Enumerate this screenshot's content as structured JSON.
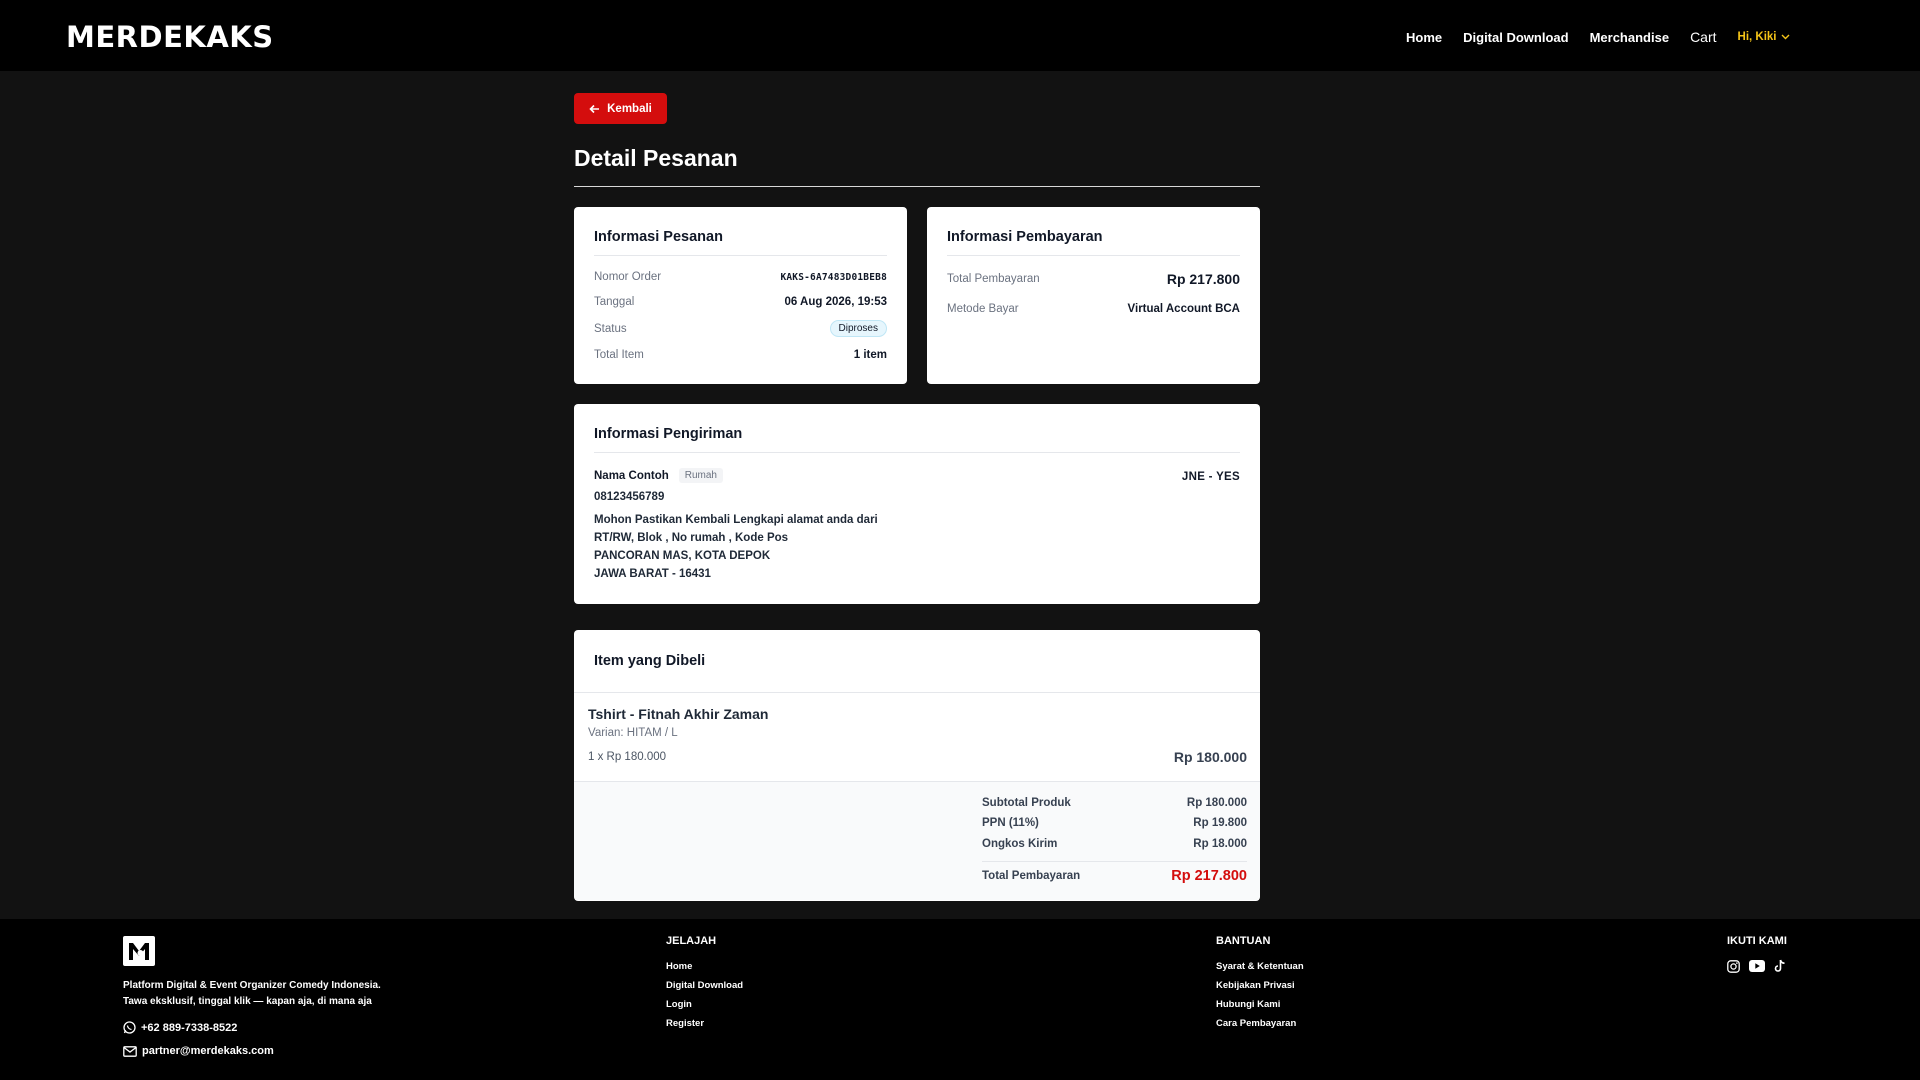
{
  "nav": {
    "logo": "MERDEKAKS",
    "links": [
      "Home",
      "Digital Download",
      "Merchandise",
      "Cart"
    ],
    "user": "Hi, Kiki"
  },
  "back_label": "Kembali",
  "page_title": "Detail Pesanan",
  "order_info": {
    "title": "Informasi Pesanan",
    "rows": [
      {
        "label": "Nomor Order",
        "value": "KAKS-6A7483D01BEB8"
      },
      {
        "label": "Tanggal",
        "value": "06 Aug 2026, 19:53"
      },
      {
        "label": "Status",
        "value": "Diproses"
      },
      {
        "label": "Total Item",
        "value": "1 item"
      }
    ]
  },
  "payment_info": {
    "title": "Informasi Pembayaran",
    "rows": [
      {
        "label": "Total Pembayaran",
        "value": "Rp 217.800"
      },
      {
        "label": "Metode Bayar",
        "value": "Virtual Account BCA"
      }
    ]
  },
  "shipping": {
    "title": "Informasi Pengiriman",
    "name": "Nama Contoh",
    "tag": "Rumah",
    "phone": "08123456789",
    "address_lines": [
      "Mohon Pastikan Kembali Lengkapi alamat anda dari",
      "RT/RW, Blok , No rumah , Kode Pos",
      "PANCORAN MAS, KOTA DEPOK",
      "JAWA BARAT - 16431"
    ],
    "courier": "JNE - YES"
  },
  "items": {
    "title": "Item yang Dibeli",
    "list": [
      {
        "name": "Tshirt - Fitnah Akhir Zaman",
        "variant": "Varian: HITAM / L",
        "qty_price": "1 x Rp 180.000",
        "subtotal": "Rp 180.000"
      }
    ],
    "summary": [
      {
        "label": "Subtotal Produk",
        "value": "Rp 180.000"
      },
      {
        "label": "PPN (11%)",
        "value": "Rp 19.800"
      },
      {
        "label": "Ongkos Kirim",
        "value": "Rp 18.000"
      }
    ],
    "total_label": "Total Pembayaran",
    "total_value": "Rp 217.800"
  },
  "footer": {
    "desc_lines": [
      "Platform Digital & Event Organizer Comedy Indonesia.",
      "Tawa eksklusif, tinggal klik — kapan aja, di mana aja"
    ],
    "phone": "+62 889-7338-8522",
    "email": "partner@merdekaks.com",
    "jelajah": {
      "title": "JELAJAH",
      "links": [
        "Home",
        "Digital Download",
        "Login",
        "Register"
      ]
    },
    "bantuan": {
      "title": "BANTUAN",
      "links": [
        "Syarat & Ketentuan",
        "Kebijakan Privasi",
        "Hubungi Kami",
        "Cara Pembayaran"
      ]
    },
    "social": {
      "title": "IKUTI KAMI",
      "icons": [
        "instagram-icon",
        "youtube-icon",
        "tiktok-icon"
      ]
    }
  },
  "colors": {
    "accent": "#d40d0d",
    "user": "#f5c518",
    "badge": "#38a9d6"
  }
}
